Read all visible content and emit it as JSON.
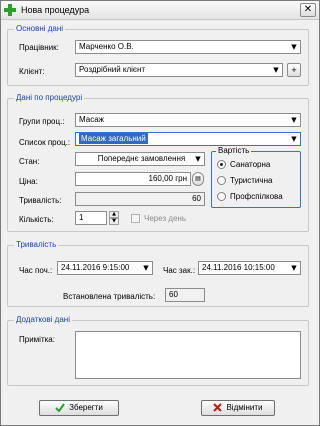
{
  "window": {
    "title": "Нова процедура",
    "close_glyph": "✕"
  },
  "main_data": {
    "group_title": "Основні дані",
    "employee_label": "Працівник:",
    "employee_value": "Марченко О.В.",
    "client_label": "Клієнт:",
    "client_value": "Роздрібний клієнт",
    "add_client_glyph": "+"
  },
  "procedure": {
    "group_title": "Дані по процедурі",
    "group_label": "Групи проц.:",
    "group_value": "Масаж",
    "list_label": "Список проц.:",
    "list_value": "Масаж загальний",
    "state_label": "Стан:",
    "state_value": "Попереднє замовлення",
    "price_label": "Ціна:",
    "price_value": "160,00 грн",
    "duration_label": "Тривалість:",
    "duration_value": "60",
    "quantity_label": "Кількість:",
    "quantity_value": "1",
    "per_day_label": "Через день",
    "cost": {
      "title": "Вартість",
      "options": [
        "Санаторна",
        "Туристична",
        "Профспілкова"
      ],
      "selected": 0
    }
  },
  "duration": {
    "group_title": "Тривалість",
    "start_label": "Час поч.:",
    "start_value": "24.11.2016  9:15:00",
    "end_label": "Час зак.:",
    "end_value": "24.11.2016 10:15:00",
    "set_label": "Встановлена тривалість:",
    "set_value": "60"
  },
  "extra": {
    "group_title": "Додаткові дані",
    "note_label": "Примітка:",
    "note_value": ""
  },
  "buttons": {
    "save": "Зберегти",
    "cancel": "Відмінити"
  },
  "colors": {
    "accent": "#1a44b8",
    "selection": "#3169c6",
    "save_icon": "#2aa02a",
    "cancel_icon": "#c01818"
  }
}
